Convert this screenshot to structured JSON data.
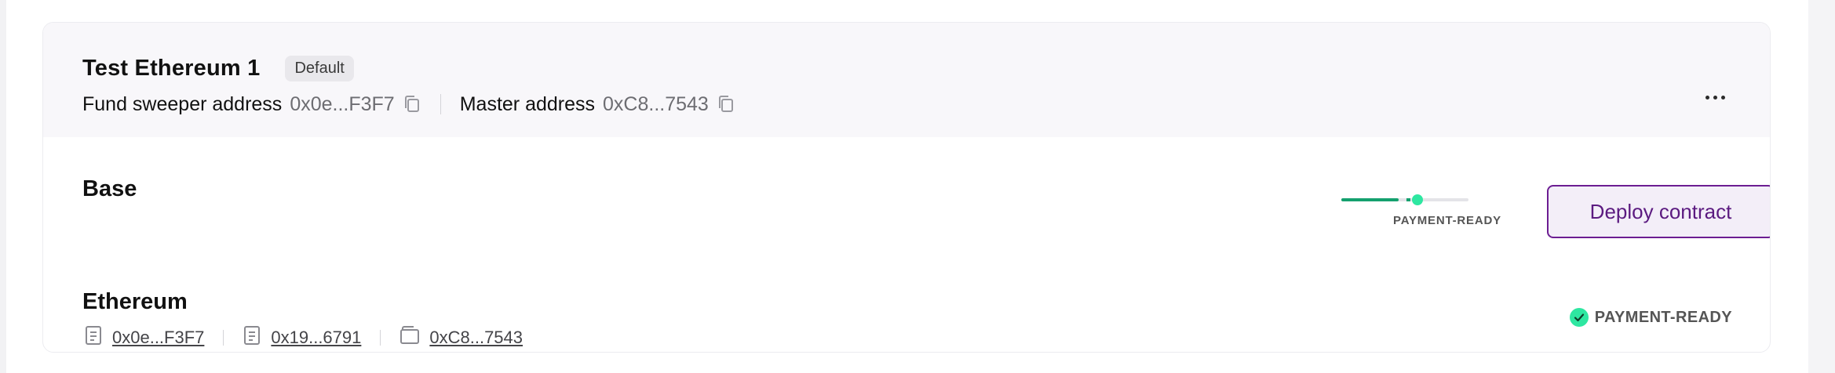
{
  "wallet": {
    "title": "Test Ethereum 1",
    "badge": "Default",
    "fund_sweeper_label": "Fund sweeper address",
    "fund_sweeper_value": "0x0e...F3F7",
    "master_label": "Master address",
    "master_value": "0xC8...7543",
    "more_icon": "more-horizontal-icon"
  },
  "base": {
    "title": "Base",
    "status_label": "PAYMENT-READY",
    "progress_fraction": 0.6,
    "deploy_label": "Deploy contract"
  },
  "ethereum": {
    "title": "Ethereum",
    "links": [
      {
        "icon": "document-icon",
        "value": "0x0e...F3F7"
      },
      {
        "icon": "document-icon",
        "value": "0x19...6791"
      },
      {
        "icon": "wallet-icon",
        "value": "0xC8...7543"
      }
    ],
    "status_label": "PAYMENT-READY"
  },
  "colors": {
    "accent_purple": "#6c1d92",
    "success_green": "#2ee7a1",
    "progress_green": "#14a06e",
    "header_bg": "#f8f7fa"
  }
}
